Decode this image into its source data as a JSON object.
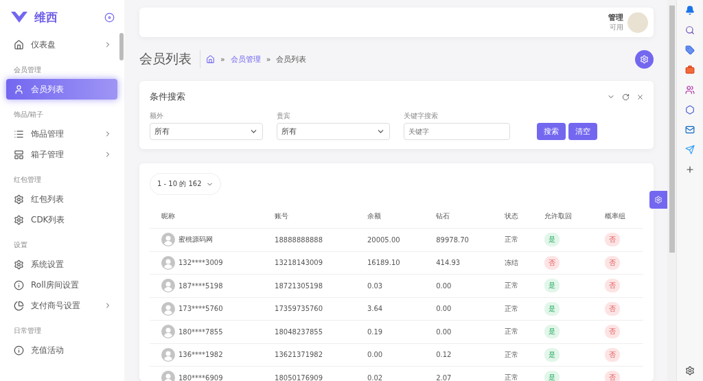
{
  "brand": {
    "name": "维西"
  },
  "sidebar": {
    "sections": [
      {
        "items": [
          {
            "label": "仪表盘",
            "expandable": true,
            "selected": false
          }
        ]
      },
      {
        "title": "会员管理",
        "items": [
          {
            "label": "会员列表",
            "expandable": false,
            "selected": true
          }
        ]
      },
      {
        "title": "饰品/箱子",
        "items": [
          {
            "label": "饰品管理",
            "expandable": true,
            "selected": false
          },
          {
            "label": "箱子管理",
            "expandable": true,
            "selected": false
          }
        ]
      },
      {
        "title": "红包管理",
        "items": [
          {
            "label": "红包列表",
            "expandable": false,
            "selected": false
          },
          {
            "label": "CDK列表",
            "expandable": false,
            "selected": false
          }
        ]
      },
      {
        "title": "设置",
        "items": [
          {
            "label": "系统设置",
            "expandable": false,
            "selected": false
          },
          {
            "label": "Roll房间设置",
            "expandable": false,
            "selected": false
          },
          {
            "label": "支付商号设置",
            "expandable": true,
            "selected": false
          }
        ]
      },
      {
        "title": "日常管理",
        "items": [
          {
            "label": "充值活动",
            "expandable": false,
            "selected": false
          }
        ]
      }
    ]
  },
  "user": {
    "name": "管理",
    "status": "可用"
  },
  "page": {
    "title": "会员列表",
    "separator": "»",
    "breadcrumb": [
      "会员管理",
      "会员列表"
    ]
  },
  "search": {
    "title": "条件搜索",
    "fields": [
      {
        "kind": "select",
        "label": "额外",
        "value": "所有"
      },
      {
        "kind": "select",
        "label": "贵宾",
        "value": "所有"
      },
      {
        "kind": "input",
        "label": "关键字搜索",
        "placeholder": "关键字"
      }
    ],
    "buttons": [
      "搜索",
      "清空"
    ]
  },
  "table": {
    "range": "1 - 10 的 162",
    "columns": [
      "昵称",
      "账号",
      "余额",
      "钻石",
      "状态",
      "允许取回",
      "概率组"
    ],
    "rows": [
      {
        "nickname": "蜜桃源码网",
        "account": "18888888888",
        "balance": "20005.00",
        "diamonds": "89978.70",
        "status": "正常",
        "retrieve": {
          "text": "是",
          "positive": true
        },
        "group": {
          "text": "否",
          "positive": false
        }
      },
      {
        "nickname": "132****3009",
        "account": "13218143009",
        "balance": "16189.10",
        "diamonds": "414.93",
        "status": "冻结",
        "retrieve": {
          "text": "否",
          "positive": false
        },
        "group": {
          "text": "否",
          "positive": false
        }
      },
      {
        "nickname": "187****5198",
        "account": "18721305198",
        "balance": "0.03",
        "diamonds": "0.00",
        "status": "正常",
        "retrieve": {
          "text": "是",
          "positive": true
        },
        "group": {
          "text": "否",
          "positive": false
        }
      },
      {
        "nickname": "173****5760",
        "account": "17359735760",
        "balance": "3.64",
        "diamonds": "0.00",
        "status": "正常",
        "retrieve": {
          "text": "是",
          "positive": true
        },
        "group": {
          "text": "否",
          "positive": false
        }
      },
      {
        "nickname": "180****7855",
        "account": "18048237855",
        "balance": "0.19",
        "diamonds": "0.00",
        "status": "正常",
        "retrieve": {
          "text": "是",
          "positive": true
        },
        "group": {
          "text": "否",
          "positive": false
        }
      },
      {
        "nickname": "136****1982",
        "account": "13621371982",
        "balance": "0.00",
        "diamonds": "0.12",
        "status": "正常",
        "retrieve": {
          "text": "是",
          "positive": true
        },
        "group": {
          "text": "否",
          "positive": false
        }
      },
      {
        "nickname": "180****6909",
        "account": "18050176909",
        "balance": "0.02",
        "diamonds": "2.07",
        "status": "正常",
        "retrieve": {
          "text": "是",
          "positive": true
        },
        "group": {
          "text": "否",
          "positive": false
        }
      }
    ]
  }
}
